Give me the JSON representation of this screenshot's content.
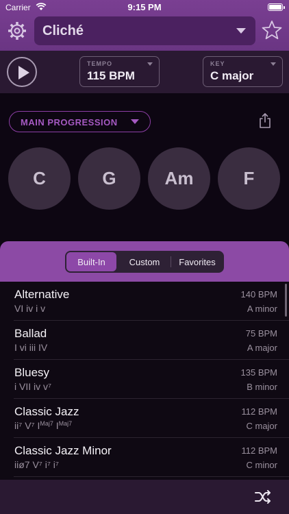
{
  "status_bar": {
    "carrier": "Carrier",
    "time": "9:15 PM"
  },
  "header": {
    "title": "Cliché"
  },
  "controls": {
    "tempo_label": "TEMPO",
    "tempo_value": "115 BPM",
    "key_label": "KEY",
    "key_value": "C major"
  },
  "progression": {
    "label": "MAIN PROGRESSION",
    "chords": [
      "C",
      "G",
      "Am",
      "F"
    ]
  },
  "library": {
    "tabs": [
      "Built-In",
      "Custom",
      "Favorites"
    ],
    "selected_tab": "Built-In",
    "items": [
      {
        "name": "Alternative",
        "numerals": "VI iv i v",
        "bpm": "140 BPM",
        "key": "A minor"
      },
      {
        "name": "Ballad",
        "numerals": "I vi iii IV",
        "bpm": "75 BPM",
        "key": "A major"
      },
      {
        "name": "Bluesy",
        "numerals": "i VII iv v⁷",
        "bpm": "135 BPM",
        "key": "B minor"
      },
      {
        "name": "Classic Jazz",
        "numerals": "ii⁷ V⁷ I^Maj7 I^Maj7",
        "bpm": "112 BPM",
        "key": "C major"
      },
      {
        "name": "Classic Jazz Minor",
        "numerals": "iiø7 V⁷ i⁷ i⁷",
        "bpm": "112 BPM",
        "key": "C minor"
      }
    ]
  },
  "colors": {
    "accent": "#8d48a8",
    "header": "#7a3f92",
    "chord_bg": "#3a2d40"
  },
  "icons": [
    "wifi-icon",
    "battery-icon",
    "gear-icon",
    "chevron-down-icon",
    "star-icon",
    "play-icon",
    "share-icon",
    "shuffle-icon"
  ]
}
